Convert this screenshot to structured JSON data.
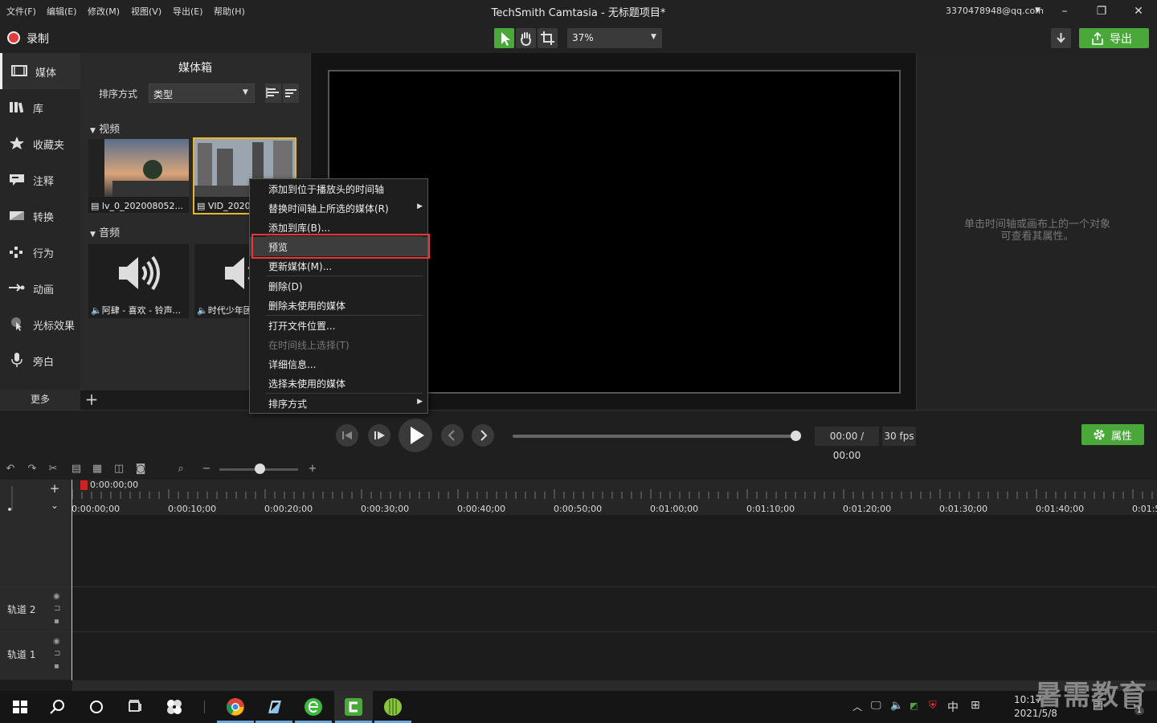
{
  "titlebar": {
    "menus": [
      "文件(F)",
      "编辑(E)",
      "修改(M)",
      "视图(V)",
      "导出(E)",
      "帮助(H)"
    ],
    "title": "TechSmith Camtasia - 无标题项目*",
    "account": "3370478948@qq.com"
  },
  "toolbar": {
    "record_label": "录制",
    "zoom_value": "37%",
    "export_label": "导出"
  },
  "leftnav": {
    "items": [
      {
        "label": "媒体",
        "icon": "film-strip-icon"
      },
      {
        "label": "库",
        "icon": "library-icon"
      },
      {
        "label": "收藏夹",
        "icon": "star-icon"
      },
      {
        "label": "注释",
        "icon": "annotation-icon"
      },
      {
        "label": "转换",
        "icon": "transition-icon"
      },
      {
        "label": "行为",
        "icon": "behavior-icon"
      },
      {
        "label": "动画",
        "icon": "animation-icon"
      },
      {
        "label": "光标效果",
        "icon": "cursor-effect-icon"
      },
      {
        "label": "旁白",
        "icon": "microphone-icon"
      }
    ],
    "more_label": "更多"
  },
  "mediabin": {
    "title": "媒体箱",
    "sort_label": "排序方式",
    "sort_value": "类型",
    "video_section": "视频",
    "audio_section": "音频",
    "videos": [
      "lv_0_202008052...",
      "VID_2020"
    ],
    "audios": [
      "阿肆 - 喜欢 - 铃声...",
      "时代少年团"
    ]
  },
  "context_menu": {
    "items": [
      {
        "label": "添加到位于播放头的时间轴",
        "disabled": false,
        "submenu": false
      },
      {
        "label": "替换时间轴上所选的媒体(R)",
        "disabled": false,
        "submenu": true
      },
      {
        "label": "添加到库(B)...",
        "disabled": false,
        "submenu": false
      },
      {
        "label": "预览",
        "disabled": false,
        "submenu": false
      },
      {
        "label": "更新媒体(M)...",
        "disabled": false,
        "submenu": false
      },
      {
        "label": "删除(D)",
        "disabled": false,
        "submenu": false
      },
      {
        "label": "删除未使用的媒体",
        "disabled": false,
        "submenu": false
      },
      {
        "label": "打开文件位置...",
        "disabled": false,
        "submenu": false
      },
      {
        "label": "在时间线上选择(T)",
        "disabled": true,
        "submenu": false
      },
      {
        "label": "详细信息...",
        "disabled": false,
        "submenu": false
      },
      {
        "label": "选择未使用的媒体",
        "disabled": false,
        "submenu": false
      },
      {
        "label": "排序方式",
        "disabled": false,
        "submenu": true
      }
    ],
    "highlighted_item": "预览"
  },
  "properties": {
    "hint_line1": "单击时间轴或画布上的一个对象",
    "hint_line2": "可查看其属性。",
    "button_label": "属性"
  },
  "playback": {
    "time": "00:00 / 00:00",
    "fps": "30 fps",
    "progress": 1.0
  },
  "timeline": {
    "playhead_time": "0:00:00;00",
    "ticks": [
      "0:00:00;00",
      "0:00:10;00",
      "0:00:20;00",
      "0:00:30;00",
      "0:00:40;00",
      "0:00:50;00",
      "0:01:00;00",
      "0:01:10;00",
      "0:01:20;00",
      "0:01:30;00",
      "0:01:40;00",
      "0:01:5"
    ],
    "tracks": [
      "轨道 2",
      "轨道 1"
    ]
  },
  "taskbar": {
    "time": "10:17",
    "date": "2021/5/8",
    "ime": "中",
    "notification_count": "1"
  },
  "watermark": "暑需教育",
  "colors": {
    "accent_green": "#4aa83a",
    "record_red": "#e23b3b",
    "highlight_red": "#e33333",
    "selection_yellow": "#e6b530"
  }
}
